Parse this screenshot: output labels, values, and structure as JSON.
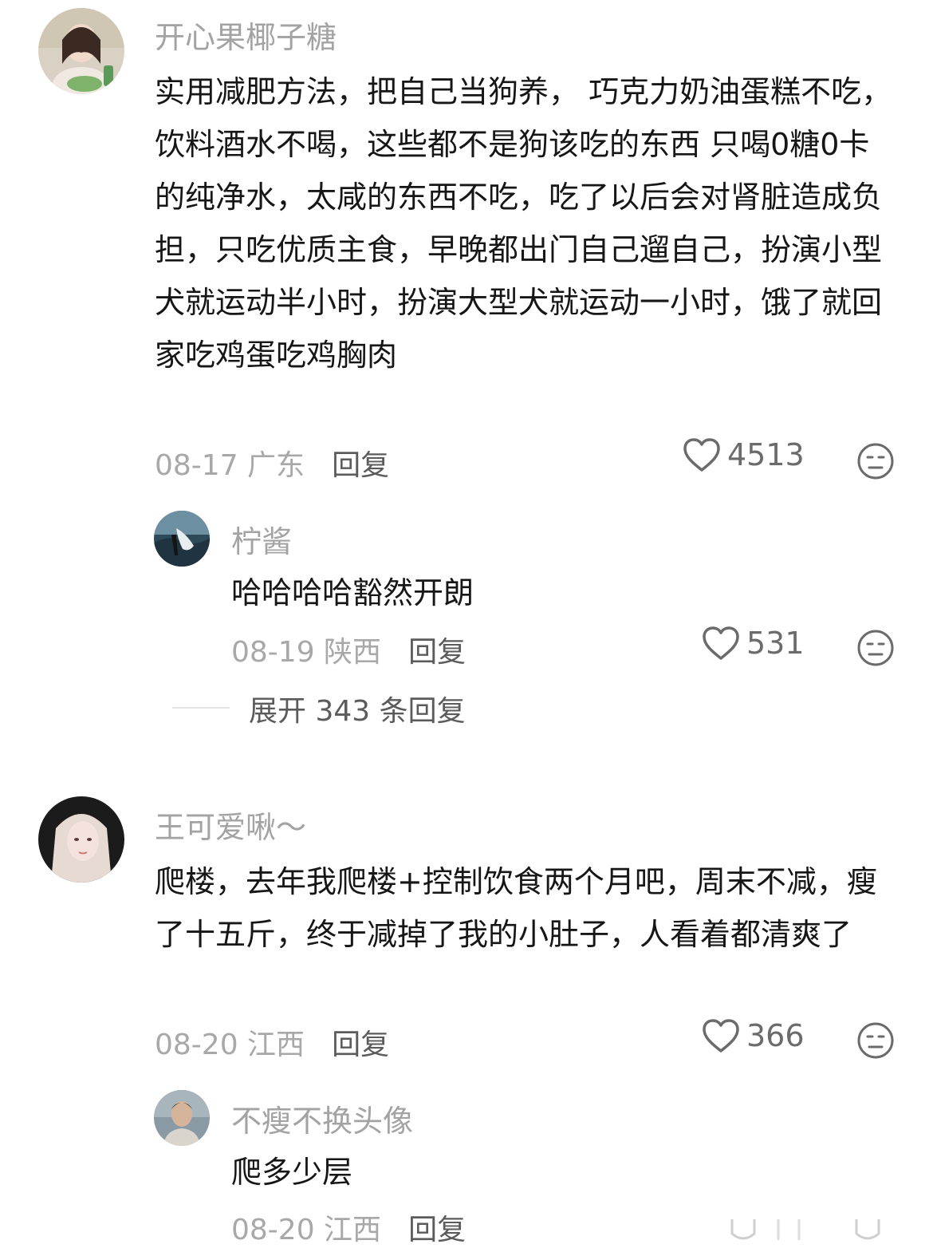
{
  "comments": [
    {
      "username": "开心果椰子糖",
      "content": "实用减肥方法，把自己当狗养， 巧克力奶油蛋糕不吃，饮料酒水不喝，这些都不是狗该吃的东西 只喝0糖0卡的纯净水，太咸的东西不吃，吃了以后会对肾脏造成负担，只吃优质主食，早晚都出门自己遛自己，扮演小型犬就运动半小时，扮演大型犬就运动一小时，饿了就回家吃鸡蛋吃鸡胸肉",
      "date_location": "08-17 广东",
      "reply_label": "回复",
      "likes": "4513",
      "replies": [
        {
          "username": "柠酱",
          "content": "哈哈哈哈豁然开朗",
          "date_location": "08-19 陕西",
          "reply_label": "回复",
          "likes": "531"
        }
      ],
      "expand_label": "展开 343 条回复"
    },
    {
      "username": "王可爱啾～",
      "content": "爬楼，去年我爬楼+控制饮食两个月吧，周末不减，瘦了十五斤，终于减掉了我的小肚子，人看着都清爽了",
      "date_location": "08-20 江西",
      "reply_label": "回复",
      "likes": "366",
      "replies": [
        {
          "username": "不瘦不换头像",
          "content": "爬多少层",
          "date_location": "08-20 江西",
          "reply_label": "回复"
        }
      ]
    }
  ],
  "icons": {
    "like": "heart-outline-icon",
    "dislike": "meh-face-icon",
    "scroll_down": "chevron-down-icon"
  }
}
